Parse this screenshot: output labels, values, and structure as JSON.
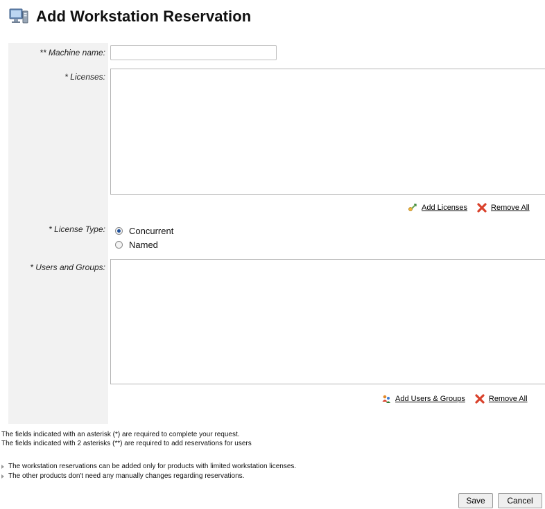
{
  "header": {
    "title": "Add Workstation Reservation",
    "icon": "workstation-icon"
  },
  "form": {
    "machine_name": {
      "label": "** Machine name:",
      "value": "",
      "placeholder": ""
    },
    "licenses": {
      "label": "* Licenses:",
      "items": []
    },
    "licenses_actions": {
      "add_label": "Add Licenses",
      "remove_label": "Remove All"
    },
    "license_type": {
      "label": "* License Type:",
      "options": [
        {
          "label": "Concurrent",
          "checked": true
        },
        {
          "label": "Named",
          "checked": false
        }
      ]
    },
    "users_groups": {
      "label": "* Users and Groups:",
      "items": []
    },
    "users_actions": {
      "add_label": "Add Users & Groups",
      "remove_label": "Remove All"
    }
  },
  "notes": {
    "line1": "The fields indicated with an asterisk (*) are required to complete your request.",
    "line2": "The fields indicated with 2 asterisks (**) are required to add reservations for users",
    "bullet1": "The workstation reservations can be added only for products with limited workstation licenses.",
    "bullet2": "The other products don't need any manually changes regarding reservations."
  },
  "buttons": {
    "save": "Save",
    "cancel": "Cancel"
  },
  "colors": {
    "radio_selected": "#1d4f9a",
    "remove_icon": "#d9412b",
    "label_bg": "#f2f2f2"
  }
}
